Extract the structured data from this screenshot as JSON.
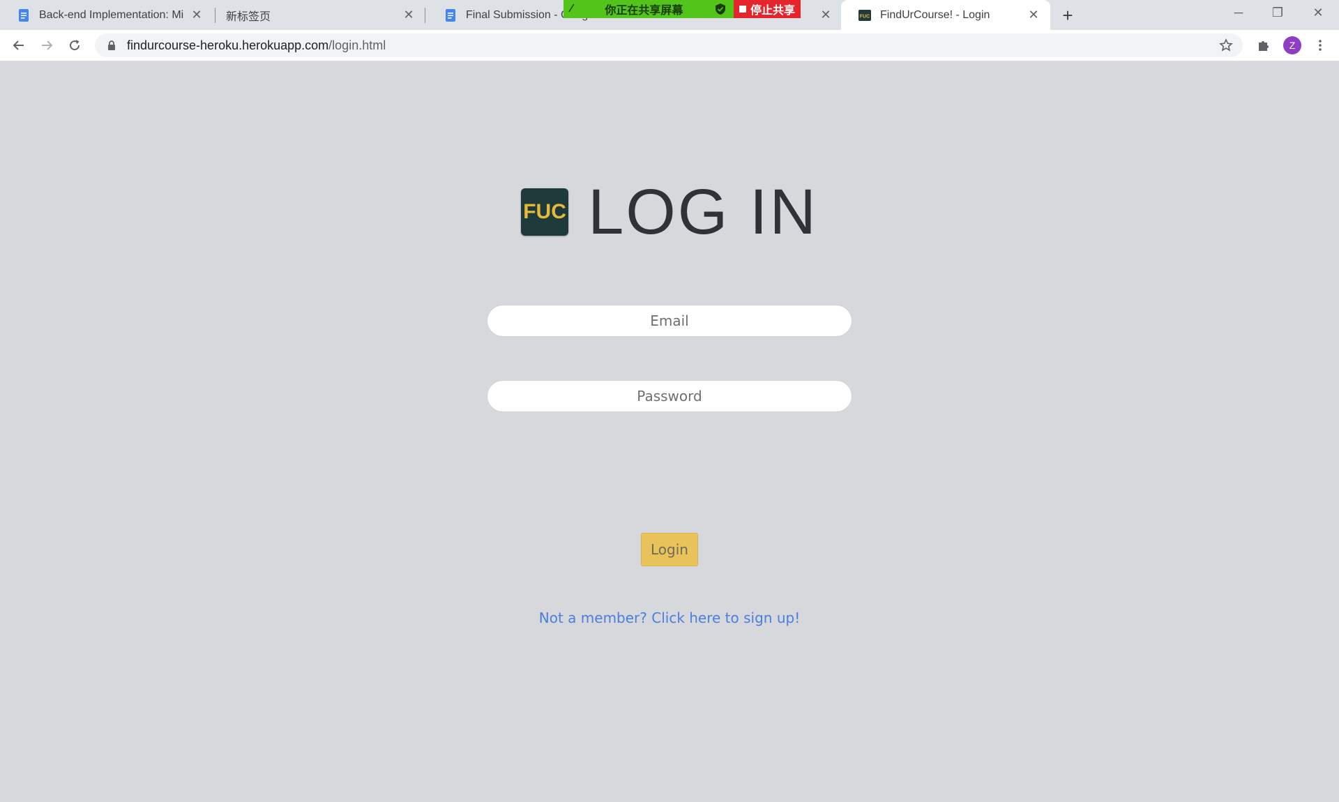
{
  "browser": {
    "tabs": [
      {
        "title": "Back-end Implementation: Mil",
        "icon": "google-docs-icon",
        "active": false
      },
      {
        "title": "新标签页",
        "icon": "",
        "active": false
      },
      {
        "title": "Final Submission - Goog",
        "icon": "google-docs-icon",
        "active": false
      },
      {
        "title": "FindUrCourse! - Login",
        "icon": "fuc-favicon-icon",
        "active": true
      }
    ],
    "share_bar": {
      "sharing_label": "你正在共享屏幕",
      "stop_label": "停止共享"
    },
    "address": {
      "host": "findurcourse-heroku.herokuapp.com",
      "path": "/login.html"
    },
    "profile_initial": "Z"
  },
  "page": {
    "logo_text": "FUC",
    "title": "LOG IN",
    "email_placeholder": "Email",
    "password_placeholder": "Password",
    "login_button": "Login",
    "signup_link": "Not a member? Click here to sign up!"
  },
  "colors": {
    "background": "#d7d8dc",
    "logo_bg": "#1f3a3a",
    "logo_text": "#e7b93a",
    "login_button": "#e8c35a",
    "link": "#4a7ee0"
  }
}
